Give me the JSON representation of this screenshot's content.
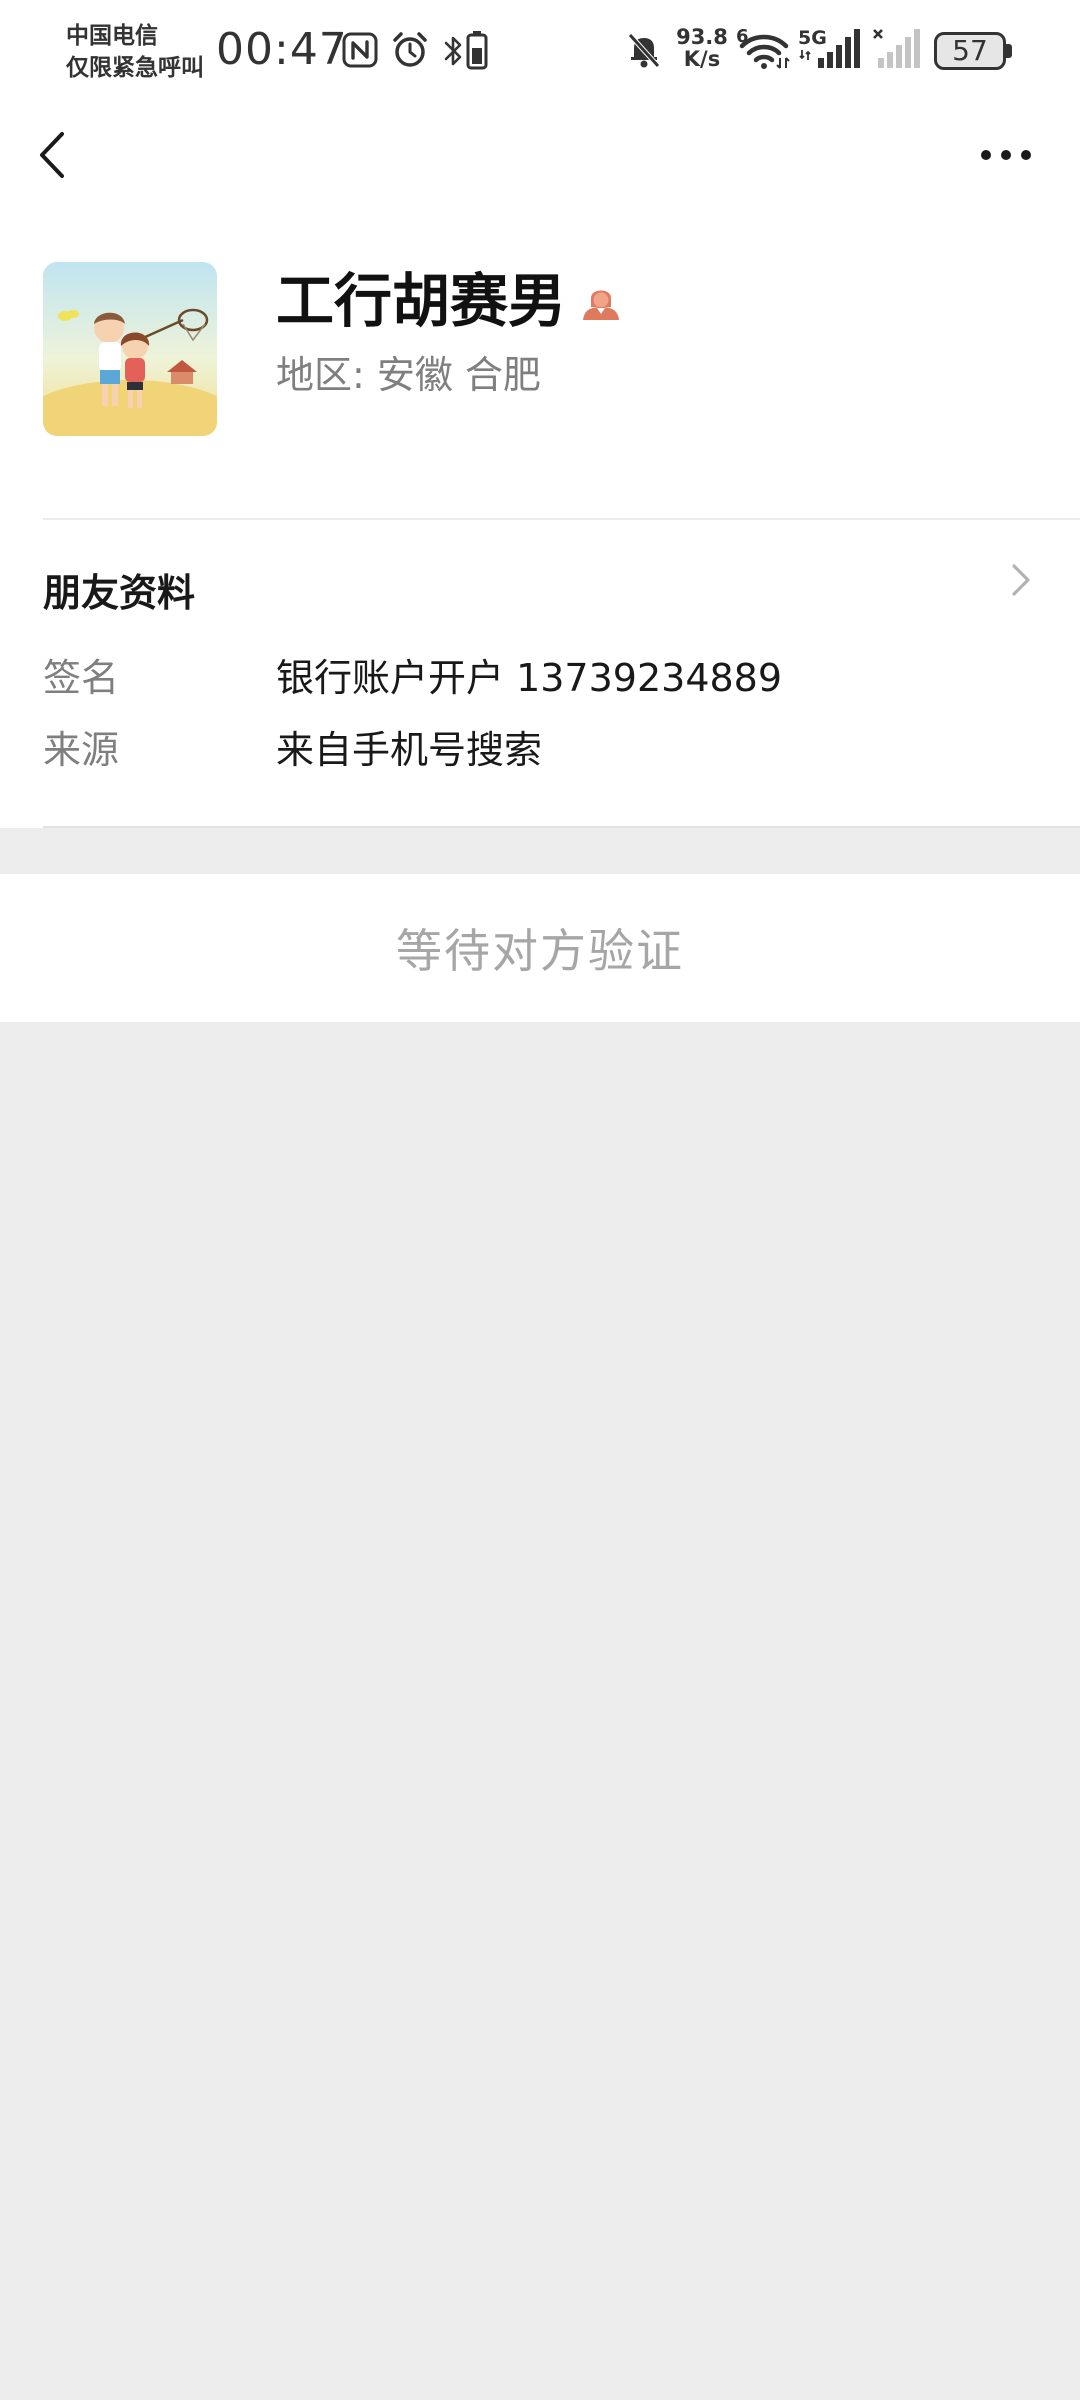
{
  "status_bar": {
    "carrier_line1": "中国电信",
    "carrier_line2": "仅限紧急呼叫",
    "time": "00:47",
    "net_speed_value": "93.8",
    "net_speed_unit": "K/s",
    "wifi_badge": "6",
    "network_type": "5G",
    "battery_level": "57",
    "icons": [
      "nfc-icon",
      "alarm-icon",
      "bluetooth-icon",
      "small-battery-icon",
      "mute-icon",
      "wifi-icon",
      "signal-icon",
      "no-signal-icon"
    ]
  },
  "nav": {
    "back_icon": "chevron-left-icon",
    "more_icon": "more-dots-icon"
  },
  "profile": {
    "nickname": "工行胡赛男",
    "gender": "female",
    "region_label": "地区:",
    "region_province": "安徽",
    "region_city": "合肥",
    "accent_color": "#e07a5f"
  },
  "friend_info": {
    "section_title": "朋友资料",
    "signature_label": "签名",
    "signature_value": "银行账户开户 13739234889",
    "source_label": "来源",
    "source_value": "来自手机号搜索"
  },
  "action": {
    "label": "等待对方验证"
  }
}
